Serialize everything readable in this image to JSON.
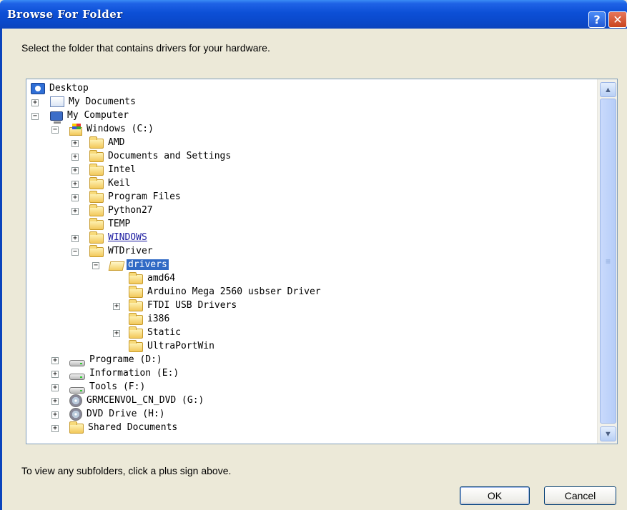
{
  "window": {
    "title": "Browse For Folder",
    "help_label": "?",
    "close_label": "✕"
  },
  "prompt": "Select the folder that contains drivers for your hardware.",
  "tree": {
    "nodes": [
      {
        "label": "Desktop",
        "icon": "desktop-icon",
        "expander": ""
      },
      {
        "label": "My Documents",
        "icon": "my-documents-icon",
        "expander": "+"
      },
      {
        "label": "My Computer",
        "icon": "my-computer-icon",
        "expander": "−"
      },
      {
        "label": "Windows (C:)",
        "icon": "windows-drive-icon",
        "expander": "−"
      },
      {
        "label": "AMD",
        "icon": "folder-icon",
        "expander": "+"
      },
      {
        "label": "Documents and Settings",
        "icon": "folder-icon",
        "expander": "+"
      },
      {
        "label": "Intel",
        "icon": "folder-icon",
        "expander": "+"
      },
      {
        "label": "Keil",
        "icon": "folder-icon",
        "expander": "+"
      },
      {
        "label": "Program Files",
        "icon": "folder-icon",
        "expander": "+"
      },
      {
        "label": "Python27",
        "icon": "folder-icon",
        "expander": "+"
      },
      {
        "label": "TEMP",
        "icon": "folder-icon",
        "expander": ""
      },
      {
        "label": "WINDOWS",
        "icon": "folder-icon",
        "expander": "+"
      },
      {
        "label": "WTDriver",
        "icon": "folder-icon",
        "expander": "−"
      },
      {
        "label": "drivers",
        "icon": "folder-open-icon",
        "expander": "−"
      },
      {
        "label": "amd64",
        "icon": "folder-icon",
        "expander": ""
      },
      {
        "label": "Arduino Mega 2560 usbser Driver",
        "icon": "folder-icon",
        "expander": ""
      },
      {
        "label": "FTDI USB Drivers",
        "icon": "folder-icon",
        "expander": "+"
      },
      {
        "label": "i386",
        "icon": "folder-icon",
        "expander": ""
      },
      {
        "label": "Static",
        "icon": "folder-icon",
        "expander": "+"
      },
      {
        "label": "UltraPortWin",
        "icon": "folder-icon",
        "expander": ""
      },
      {
        "label": "Programe (D:)",
        "icon": "hard-drive-icon",
        "expander": "+"
      },
      {
        "label": "Information (E:)",
        "icon": "hard-drive-icon",
        "expander": "+"
      },
      {
        "label": "Tools (F:)",
        "icon": "hard-drive-icon",
        "expander": "+"
      },
      {
        "label": "GRMCENVOL_CN_DVD (G:)",
        "icon": "dvd-drive-icon",
        "expander": "+"
      },
      {
        "label": "DVD Drive (H:)",
        "icon": "dvd-drive-icon",
        "expander": "+"
      },
      {
        "label": "Shared Documents",
        "icon": "folder-icon",
        "expander": "+"
      }
    ],
    "selected": "drivers"
  },
  "scrollbar": {
    "up_icon": "chevron-up-icon",
    "down_icon": "chevron-down-icon",
    "grip": "≡"
  },
  "hint": "To view any subfolders, click a plus sign above.",
  "buttons": {
    "ok": "OK",
    "cancel": "Cancel"
  }
}
